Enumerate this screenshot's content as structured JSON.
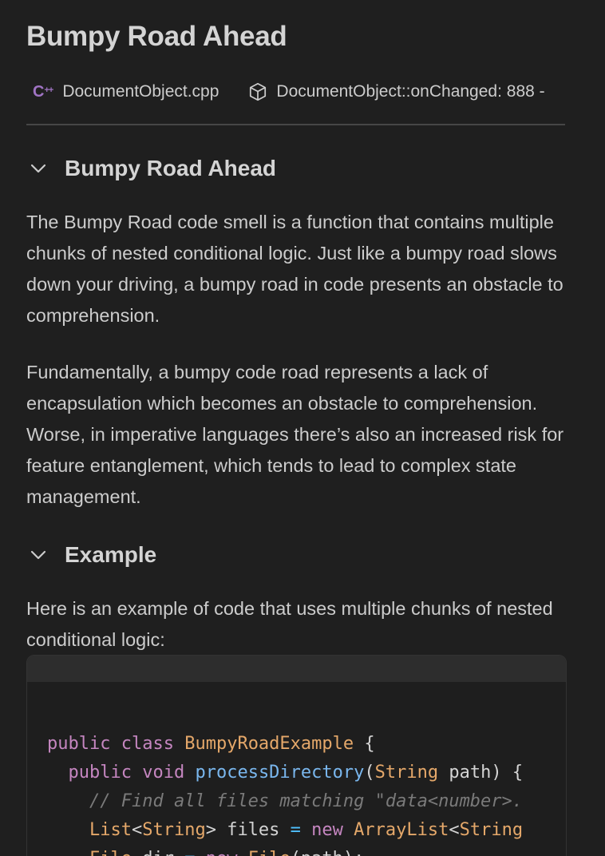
{
  "page": {
    "title": "Bumpy Road Ahead"
  },
  "meta": {
    "file_name": "DocumentObject.cpp",
    "file_icon": "cpp-icon",
    "function_ref": "DocumentObject::onChanged: 888 -",
    "function_icon": "cube-icon"
  },
  "sections": [
    {
      "title": "Bumpy Road Ahead",
      "paragraphs": [
        "The Bumpy Road code smell is a function that contains multiple chunks of nested conditional logic. Just like a bumpy road slows down your driving, a bumpy road in code presents an obstacle to comprehension.",
        "Fundamentally, a bumpy code road represents a lack of encapsulation which becomes an obstacle to comprehension. Worse, in imperative languages there’s also an increased risk for feature entanglement, which tends to lead to complex state management."
      ]
    },
    {
      "title": "Example",
      "paragraphs": [
        "Here is an example of code that uses multiple chunks of nested conditional logic:"
      ]
    }
  ],
  "code": {
    "lines": [
      [
        {
          "t": "public",
          "c": "kw"
        },
        {
          "t": " ",
          "c": "pl"
        },
        {
          "t": "class",
          "c": "kw"
        },
        {
          "t": " ",
          "c": "pl"
        },
        {
          "t": "BumpyRoadExample",
          "c": "ty"
        },
        {
          "t": " {",
          "c": "pl"
        }
      ],
      [
        {
          "t": "  ",
          "c": "pl"
        },
        {
          "t": "public",
          "c": "kw"
        },
        {
          "t": " ",
          "c": "pl"
        },
        {
          "t": "void",
          "c": "kw"
        },
        {
          "t": " ",
          "c": "pl"
        },
        {
          "t": "processDirectory",
          "c": "fn"
        },
        {
          "t": "(",
          "c": "pl"
        },
        {
          "t": "String",
          "c": "ty"
        },
        {
          "t": " path) {",
          "c": "pl"
        }
      ],
      [
        {
          "t": "    ",
          "c": "pl"
        },
        {
          "t": "// Find all files matching \"data<number>.",
          "c": "cm"
        }
      ],
      [
        {
          "t": "    ",
          "c": "pl"
        },
        {
          "t": "List",
          "c": "ty"
        },
        {
          "t": "<",
          "c": "pl"
        },
        {
          "t": "String",
          "c": "ty"
        },
        {
          "t": "> files ",
          "c": "pl"
        },
        {
          "t": "=",
          "c": "op"
        },
        {
          "t": " ",
          "c": "pl"
        },
        {
          "t": "new",
          "c": "kw"
        },
        {
          "t": " ",
          "c": "pl"
        },
        {
          "t": "ArrayList",
          "c": "ty"
        },
        {
          "t": "<",
          "c": "pl"
        },
        {
          "t": "String",
          "c": "ty"
        }
      ],
      [
        {
          "t": "    ",
          "c": "pl"
        },
        {
          "t": "File",
          "c": "ty"
        },
        {
          "t": " dir ",
          "c": "pl"
        },
        {
          "t": "=",
          "c": "op"
        },
        {
          "t": " ",
          "c": "pl"
        },
        {
          "t": "new",
          "c": "kw"
        },
        {
          "t": " ",
          "c": "pl"
        },
        {
          "t": "File",
          "c": "ty"
        },
        {
          "t": "(path);",
          "c": "pl"
        }
      ]
    ]
  },
  "colors": {
    "background": "#1f1f1f",
    "cpp_icon": "#a074c4",
    "keyword": "#c586c0",
    "type": "#e5a86a",
    "function": "#7ab7ee",
    "comment": "#7a7a7a"
  }
}
